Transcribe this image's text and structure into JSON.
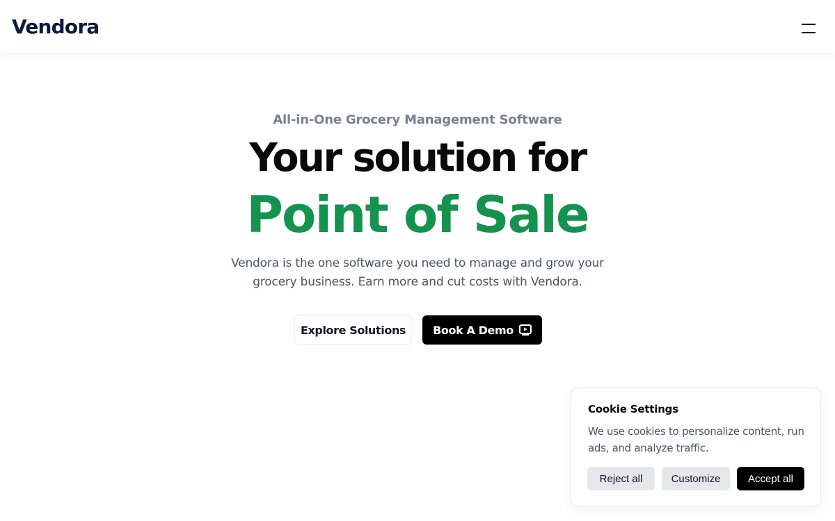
{
  "header": {
    "logo": "Vendora",
    "menu_icon": "hamburger-menu-icon"
  },
  "hero": {
    "eyebrow": "All-in-One Grocery Management Software",
    "headline": "Your solution for",
    "headline_accent": "Point of Sale",
    "description": "Vendora is the one software you need to manage and grow your grocery business. Earn more and cut costs with Vendora.",
    "explore_button": "Explore Solutions",
    "demo_button": "Book A Demo",
    "demo_icon": "play-video-icon"
  },
  "cookie": {
    "title": "Cookie Settings",
    "text": "We use cookies to personalize content, run ads, and analyze traffic.",
    "reject": "Reject all",
    "customize": "Customize",
    "accept": "Accept all"
  },
  "colors": {
    "accent_green": "#14934f",
    "dark_navy": "#0b1b3b",
    "button_black": "#000000"
  }
}
